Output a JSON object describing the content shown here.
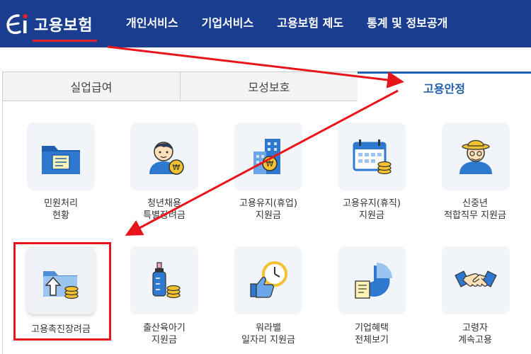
{
  "header": {
    "logo_text": "고용보험",
    "nav": [
      "개인서비스",
      "기업서비스",
      "고용보험 제도",
      "통계 및 정보공개"
    ]
  },
  "tabs": [
    {
      "label": "실업급여",
      "active": false
    },
    {
      "label": "모성보호",
      "active": false
    },
    {
      "label": "고용안정",
      "active": true
    }
  ],
  "services": [
    {
      "label": [
        "민원처리",
        "현황"
      ],
      "icon": "folder-document-icon"
    },
    {
      "label": [
        "청년채용",
        "특별장려금"
      ],
      "icon": "young-person-won-icon"
    },
    {
      "label": [
        "고용유지(휴업)",
        "지원금"
      ],
      "icon": "building-won-icon"
    },
    {
      "label": [
        "고용유지(휴직)",
        "지원금"
      ],
      "icon": "calendar-coins-icon"
    },
    {
      "label": [
        "신중년",
        "적합직무 지원금"
      ],
      "icon": "senior-person-icon"
    },
    {
      "label": [
        "고용촉진장려금",
        ""
      ],
      "icon": "folder-coins-icon",
      "highlighted": true
    },
    {
      "label": [
        "출산육아기",
        "지원금"
      ],
      "icon": "baby-bottle-coins-icon"
    },
    {
      "label": [
        "워라밸",
        "일자리 지원금"
      ],
      "icon": "thumbs-up-clock-icon"
    },
    {
      "label": [
        "기업혜택",
        "전체보기"
      ],
      "icon": "pie-chart-document-icon"
    },
    {
      "label": [
        "고령자",
        "계속고용"
      ],
      "icon": "handshake-icon"
    }
  ],
  "colors": {
    "header_bg": "#1a3d8f",
    "active_tab": "#1f5ea8",
    "highlight": "#e8141b",
    "icon_blue": "#2f78d0",
    "icon_yellow": "#f2c230"
  }
}
